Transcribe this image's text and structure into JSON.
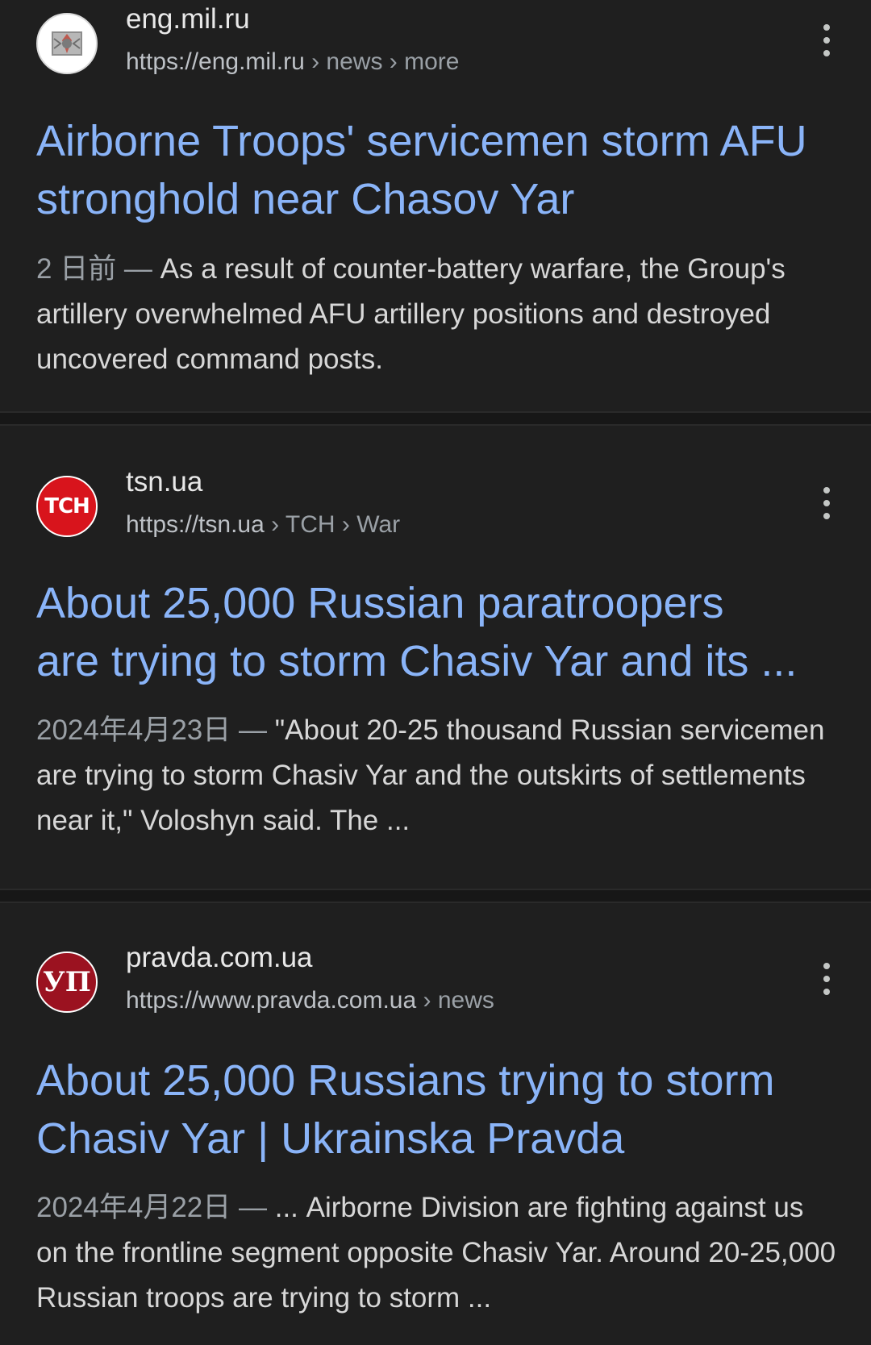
{
  "results": [
    {
      "site_name": "eng.mil.ru",
      "url_host": "https://eng.mil.ru",
      "url_path": " › news › more",
      "title": "Airborne Troops' servicemen storm AFU stronghold near Chasov Yar",
      "date": "2 日前 — ",
      "snippet": "As a result of counter-battery warfare, the Group's artillery overwhelmed AFU artillery positions and destroyed uncovered command posts.",
      "favicon_icon": "emblem-icon"
    },
    {
      "site_name": "tsn.ua",
      "url_host": "https://tsn.ua",
      "url_path": " › TCH › War",
      "favicon_text": "TCH",
      "title_line1": "About 25,000 Russian paratroopers",
      "title_line2": "are trying to storm Chasiv Yar and its ...",
      "date": "2024年4月23日 — ",
      "snippet": "\"About 20-25 thousand Russian servicemen are trying to storm Chasiv Yar and the outskirts of settlements near it,\" Voloshyn said. The ..."
    },
    {
      "site_name": "pravda.com.ua",
      "url_host": "https://www.pravda.com.ua",
      "url_path": " › news",
      "favicon_text": "УП",
      "title": "About 25,000 Russians trying to storm Chasiv Yar | Ukrainska Pravda",
      "date": "2024年4月22日 — ",
      "snippet": "... Airborne Division are fighting against us on the frontline segment opposite Chasiv Yar. Around 20-25,000 Russian troops are trying to storm ..."
    }
  ],
  "colors": {
    "background": "#1f1f1f",
    "title_link": "#8ab4f8",
    "divider": "#171717"
  }
}
